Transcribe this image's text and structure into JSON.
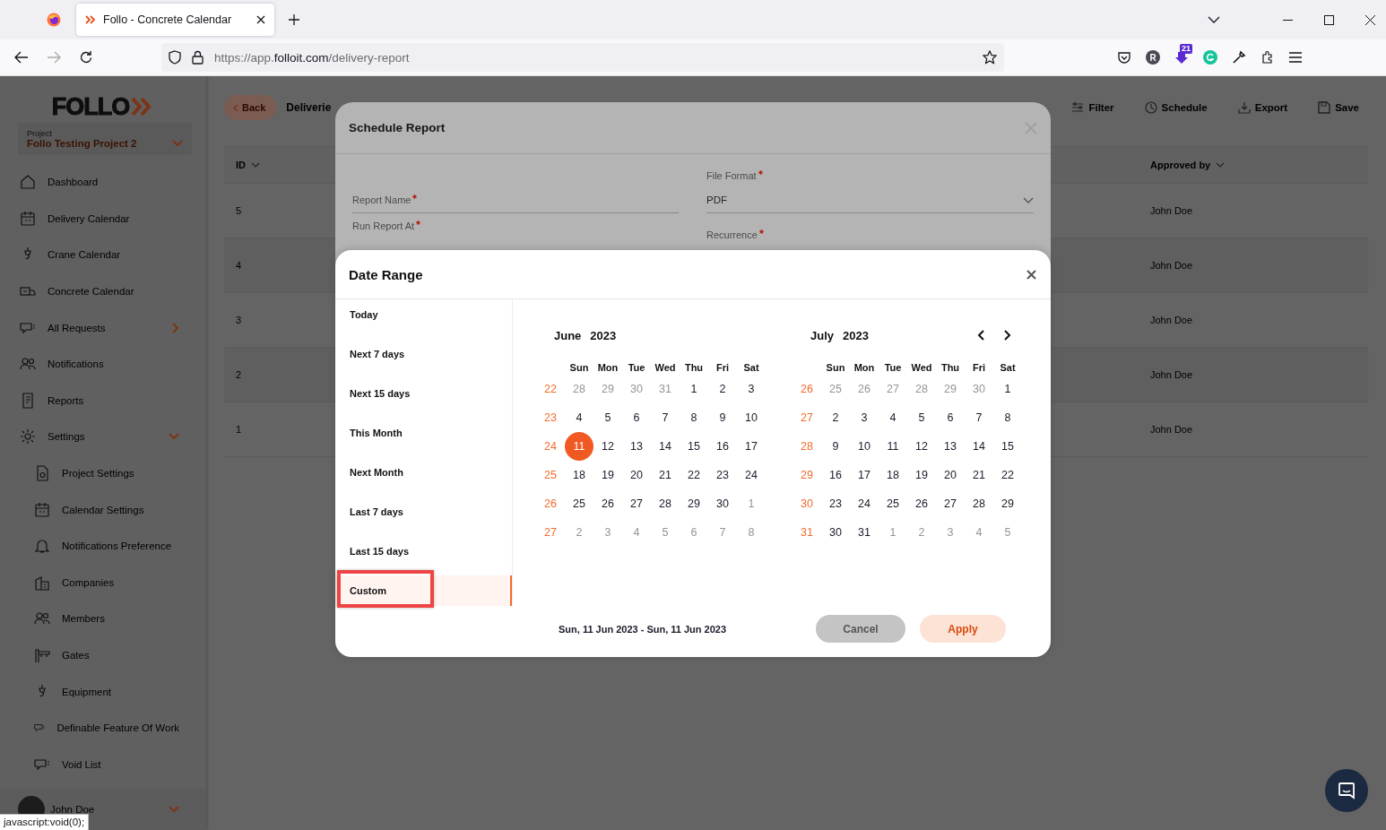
{
  "browser": {
    "tab_title": "Follo - Concrete Calendar",
    "url_prefix": "https://app.",
    "url_domain": "folloit.com",
    "url_path": "/delivery-report",
    "profile_letter": "R",
    "extension_badge": "21"
  },
  "sidebar": {
    "logo": "FOLLO",
    "project_label": "Project",
    "project_name": "Follo Testing Project 2",
    "items": [
      {
        "label": "Dashboard"
      },
      {
        "label": "Delivery Calendar"
      },
      {
        "label": "Crane Calendar"
      },
      {
        "label": "Concrete Calendar"
      },
      {
        "label": "All Requests",
        "expanded": false
      },
      {
        "label": "Notifications"
      },
      {
        "label": "Reports"
      },
      {
        "label": "Settings",
        "expanded": true,
        "children": [
          {
            "label": "Project Settings"
          },
          {
            "label": "Calendar Settings"
          },
          {
            "label": "Notifications Preference"
          },
          {
            "label": "Companies"
          },
          {
            "label": "Members"
          },
          {
            "label": "Gates"
          },
          {
            "label": "Equipment"
          },
          {
            "label": "Definable Feature Of Work"
          },
          {
            "label": "Void List"
          }
        ]
      }
    ],
    "user": {
      "name": "John Doe"
    }
  },
  "page": {
    "back": "Back",
    "title": "Deliverie",
    "actions": [
      "Filter",
      "Schedule",
      "Export",
      "Save"
    ],
    "table": {
      "columns": [
        "ID",
        "Approved by"
      ],
      "rows": [
        {
          "id": "5",
          "approved_by": "John Doe"
        },
        {
          "id": "4",
          "approved_by": "John Doe"
        },
        {
          "id": "3",
          "approved_by": "John Doe"
        },
        {
          "id": "2",
          "approved_by": "John Doe"
        },
        {
          "id": "1",
          "approved_by": "John Doe"
        }
      ]
    }
  },
  "schedule_modal": {
    "title": "Schedule Report",
    "fields": [
      {
        "label": "Report Name",
        "required": true
      },
      {
        "label": "File Format",
        "required": true,
        "value": "PDF"
      },
      {
        "label": "Run Report At",
        "required": true
      },
      {
        "label": "Recurrence",
        "required": true
      }
    ]
  },
  "date_range": {
    "title": "Date Range",
    "presets": [
      {
        "label": "Today",
        "selected": false,
        "highlighted": false
      },
      {
        "label": "Next 7 days",
        "selected": false,
        "highlighted": false
      },
      {
        "label": "Next 15 days",
        "selected": false,
        "highlighted": false
      },
      {
        "label": "This Month",
        "selected": false,
        "highlighted": false
      },
      {
        "label": "Next Month",
        "selected": false,
        "highlighted": false
      },
      {
        "label": "Last 7 days",
        "selected": false,
        "highlighted": false
      },
      {
        "label": "Last 15 days",
        "selected": false,
        "highlighted": false
      },
      {
        "label": "Custom",
        "selected": true,
        "highlighted": true
      }
    ],
    "months": [
      {
        "month": "June",
        "year": "2023",
        "weekdays": [
          "Sun",
          "Mon",
          "Tue",
          "Wed",
          "Thu",
          "Fri",
          "Sat"
        ],
        "weeks": [
          {
            "week": "22",
            "days": [
              {
                "d": "28",
                "muted": true,
                "selected": false
              },
              {
                "d": "29",
                "muted": true,
                "selected": false
              },
              {
                "d": "30",
                "muted": true,
                "selected": false
              },
              {
                "d": "31",
                "muted": true,
                "selected": false
              },
              {
                "d": "1",
                "muted": false,
                "selected": false
              },
              {
                "d": "2",
                "muted": false,
                "selected": false
              },
              {
                "d": "3",
                "muted": false,
                "selected": false
              }
            ]
          },
          {
            "week": "23",
            "days": [
              {
                "d": "4",
                "muted": false,
                "selected": false
              },
              {
                "d": "5",
                "muted": false,
                "selected": false
              },
              {
                "d": "6",
                "muted": false,
                "selected": false
              },
              {
                "d": "7",
                "muted": false,
                "selected": false
              },
              {
                "d": "8",
                "muted": false,
                "selected": false
              },
              {
                "d": "9",
                "muted": false,
                "selected": false
              },
              {
                "d": "10",
                "muted": false,
                "selected": false
              }
            ]
          },
          {
            "week": "24",
            "days": [
              {
                "d": "11",
                "muted": false,
                "selected": true
              },
              {
                "d": "12",
                "muted": false,
                "selected": false
              },
              {
                "d": "13",
                "muted": false,
                "selected": false
              },
              {
                "d": "14",
                "muted": false,
                "selected": false
              },
              {
                "d": "15",
                "muted": false,
                "selected": false
              },
              {
                "d": "16",
                "muted": false,
                "selected": false
              },
              {
                "d": "17",
                "muted": false,
                "selected": false
              }
            ]
          },
          {
            "week": "25",
            "days": [
              {
                "d": "18",
                "muted": false,
                "selected": false
              },
              {
                "d": "19",
                "muted": false,
                "selected": false
              },
              {
                "d": "20",
                "muted": false,
                "selected": false
              },
              {
                "d": "21",
                "muted": false,
                "selected": false
              },
              {
                "d": "22",
                "muted": false,
                "selected": false
              },
              {
                "d": "23",
                "muted": false,
                "selected": false
              },
              {
                "d": "24",
                "muted": false,
                "selected": false
              }
            ]
          },
          {
            "week": "26",
            "days": [
              {
                "d": "25",
                "muted": false,
                "selected": false
              },
              {
                "d": "26",
                "muted": false,
                "selected": false
              },
              {
                "d": "27",
                "muted": false,
                "selected": false
              },
              {
                "d": "28",
                "muted": false,
                "selected": false
              },
              {
                "d": "29",
                "muted": false,
                "selected": false
              },
              {
                "d": "30",
                "muted": false,
                "selected": false
              },
              {
                "d": "1",
                "muted": true,
                "selected": false
              }
            ]
          },
          {
            "week": "27",
            "days": [
              {
                "d": "2",
                "muted": true,
                "selected": false
              },
              {
                "d": "3",
                "muted": true,
                "selected": false
              },
              {
                "d": "4",
                "muted": true,
                "selected": false
              },
              {
                "d": "5",
                "muted": true,
                "selected": false
              },
              {
                "d": "6",
                "muted": true,
                "selected": false
              },
              {
                "d": "7",
                "muted": true,
                "selected": false
              },
              {
                "d": "8",
                "muted": true,
                "selected": false
              }
            ]
          }
        ]
      },
      {
        "month": "July",
        "year": "2023",
        "weekdays": [
          "Sun",
          "Mon",
          "Tue",
          "Wed",
          "Thu",
          "Fri",
          "Sat"
        ],
        "weeks": [
          {
            "week": "26",
            "days": [
              {
                "d": "25",
                "muted": true,
                "selected": false
              },
              {
                "d": "26",
                "muted": true,
                "selected": false
              },
              {
                "d": "27",
                "muted": true,
                "selected": false
              },
              {
                "d": "28",
                "muted": true,
                "selected": false
              },
              {
                "d": "29",
                "muted": true,
                "selected": false
              },
              {
                "d": "30",
                "muted": true,
                "selected": false
              },
              {
                "d": "1",
                "muted": false,
                "selected": false
              }
            ]
          },
          {
            "week": "27",
            "days": [
              {
                "d": "2",
                "muted": false,
                "selected": false
              },
              {
                "d": "3",
                "muted": false,
                "selected": false
              },
              {
                "d": "4",
                "muted": false,
                "selected": false
              },
              {
                "d": "5",
                "muted": false,
                "selected": false
              },
              {
                "d": "6",
                "muted": false,
                "selected": false
              },
              {
                "d": "7",
                "muted": false,
                "selected": false
              },
              {
                "d": "8",
                "muted": false,
                "selected": false
              }
            ]
          },
          {
            "week": "28",
            "days": [
              {
                "d": "9",
                "muted": false,
                "selected": false
              },
              {
                "d": "10",
                "muted": false,
                "selected": false
              },
              {
                "d": "11",
                "muted": false,
                "selected": false
              },
              {
                "d": "12",
                "muted": false,
                "selected": false
              },
              {
                "d": "13",
                "muted": false,
                "selected": false
              },
              {
                "d": "14",
                "muted": false,
                "selected": false
              },
              {
                "d": "15",
                "muted": false,
                "selected": false
              }
            ]
          },
          {
            "week": "29",
            "days": [
              {
                "d": "16",
                "muted": false,
                "selected": false
              },
              {
                "d": "17",
                "muted": false,
                "selected": false
              },
              {
                "d": "18",
                "muted": false,
                "selected": false
              },
              {
                "d": "19",
                "muted": false,
                "selected": false
              },
              {
                "d": "20",
                "muted": false,
                "selected": false
              },
              {
                "d": "21",
                "muted": false,
                "selected": false
              },
              {
                "d": "22",
                "muted": false,
                "selected": false
              }
            ]
          },
          {
            "week": "30",
            "days": [
              {
                "d": "23",
                "muted": false,
                "selected": false
              },
              {
                "d": "24",
                "muted": false,
                "selected": false
              },
              {
                "d": "25",
                "muted": false,
                "selected": false
              },
              {
                "d": "26",
                "muted": false,
                "selected": false
              },
              {
                "d": "27",
                "muted": false,
                "selected": false
              },
              {
                "d": "28",
                "muted": false,
                "selected": false
              },
              {
                "d": "29",
                "muted": false,
                "selected": false
              }
            ]
          },
          {
            "week": "31",
            "days": [
              {
                "d": "30",
                "muted": false,
                "selected": false
              },
              {
                "d": "31",
                "muted": false,
                "selected": false
              },
              {
                "d": "1",
                "muted": true,
                "selected": false
              },
              {
                "d": "2",
                "muted": true,
                "selected": false
              },
              {
                "d": "3",
                "muted": true,
                "selected": false
              },
              {
                "d": "4",
                "muted": true,
                "selected": false
              },
              {
                "d": "5",
                "muted": true,
                "selected": false
              }
            ]
          }
        ]
      }
    ],
    "range_text": "Sun, 11 Jun 2023 - Sun, 11 Jun 2023",
    "buttons": [
      {
        "label": "Cancel",
        "kind": "secondary"
      },
      {
        "label": "Apply",
        "kind": "primary"
      }
    ]
  },
  "status_tooltip": "javascript:void(0);"
}
